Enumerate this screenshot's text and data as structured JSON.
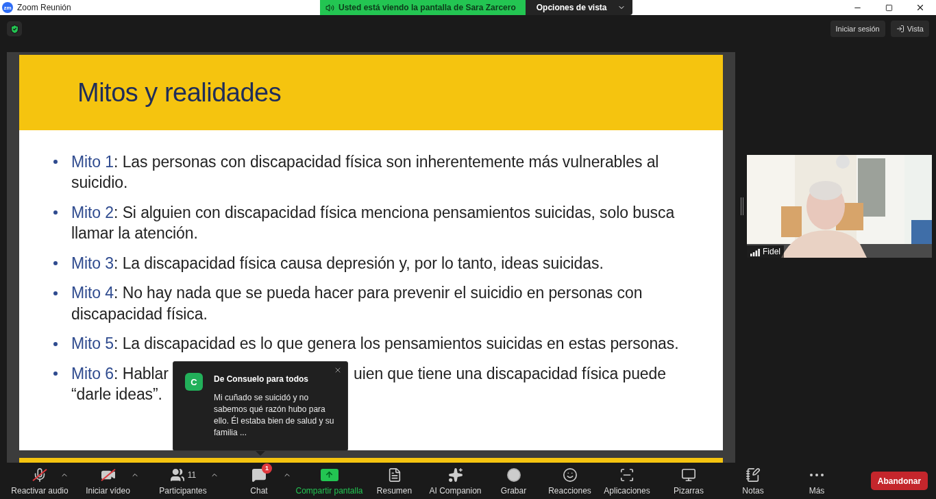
{
  "window": {
    "logo": "zm",
    "title": "Zoom Reunión"
  },
  "share_banner": {
    "text": "Usted está viendo la pantalla de Sara Zarcero",
    "options": "Opciones de vista"
  },
  "top_bar": {
    "sign_in": "Iniciar sesión",
    "view": "Vista"
  },
  "slide": {
    "title": "Mitos y realidades",
    "bullets": [
      {
        "label": "Mito 1",
        "lines": [
          ": Las personas con discapacidad física son inherentemente más vulnerables al",
          "suicidio."
        ]
      },
      {
        "label": "Mito 2",
        "lines": [
          ": Si alguien con discapacidad física menciona pensamientos suicidas, solo busca",
          "llamar la atención."
        ]
      },
      {
        "label": "Mito 3",
        "lines": [
          ": La discapacidad física causa depresión y, por lo tanto, ideas suicidas."
        ]
      },
      {
        "label": "Mito 4",
        "lines": [
          ": No hay nada que se pueda hacer para prevenir el suicidio en personas con",
          "discapacidad física."
        ]
      },
      {
        "label": "Mito 5",
        "lines": [
          ": La discapacidad es lo que genera los pensamientos suicidas en estas personas."
        ]
      },
      {
        "label": "Mito 6",
        "lines": [
          ": Hablar",
          "“darle ideas”."
        ],
        "hidden_after_first": "uien que tiene una discapacidad física puede"
      }
    ]
  },
  "chat_popup": {
    "avatar": "C",
    "sender": "De Consuelo para todos",
    "message": "Mi cuñado se suicidó y no sabemos qué razón hubo para ello. Él estaba bien de salud y su familia ..."
  },
  "video_tile": {
    "name": "Fidel"
  },
  "toolbar": [
    {
      "label": "Reactivar audio",
      "caret": true,
      "off": true
    },
    {
      "label": "Iniciar vídeo",
      "caret": true,
      "off": true
    },
    {
      "label": "Participantes",
      "caret": true,
      "count": "11"
    },
    {
      "label": "Chat",
      "caret": true,
      "badge": "1"
    },
    {
      "label": "Compartir pantalla",
      "caret": false,
      "highlight": true
    },
    {
      "label": "Resumen",
      "caret": false
    },
    {
      "label": "AI Companion",
      "caret": false
    },
    {
      "label": "Grabar",
      "caret": false
    },
    {
      "label": "Reacciones",
      "caret": false
    },
    {
      "label": "Aplicaciones",
      "caret": false
    },
    {
      "label": "Pizarras",
      "caret": false
    },
    {
      "label": "Notas",
      "caret": false
    },
    {
      "label": "Más",
      "caret": false
    }
  ],
  "leave_button": "Abandonar"
}
